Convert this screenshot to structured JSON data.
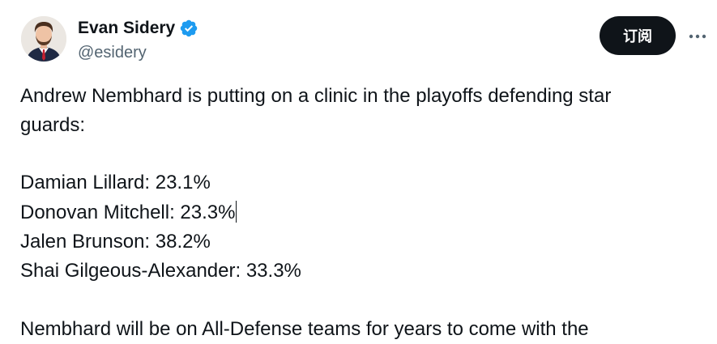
{
  "author": {
    "display_name": "Evan Sidery",
    "handle": "@esidery",
    "verified": true
  },
  "actions": {
    "subscribe_label": "订阅",
    "more_icon": "more-horizontal-icon"
  },
  "tweet": {
    "intro_line_1": "Andrew Nembhard is putting on a clinic in the playoffs defending star",
    "intro_line_2": "guards:",
    "stats": [
      "Damian Lillard: 23.1%",
      "Donovan Mitchell: 23.3%",
      "Jalen Brunson: 38.2%",
      "Shai Gilgeous-Alexander: 33.3%"
    ],
    "outro_line_1": "Nembhard will be on All-Defense teams for years to come with the"
  },
  "colors": {
    "text_primary": "#0f1419",
    "text_secondary": "#536471",
    "verified_blue": "#1d9bf0",
    "button_bg": "#0f1419"
  }
}
